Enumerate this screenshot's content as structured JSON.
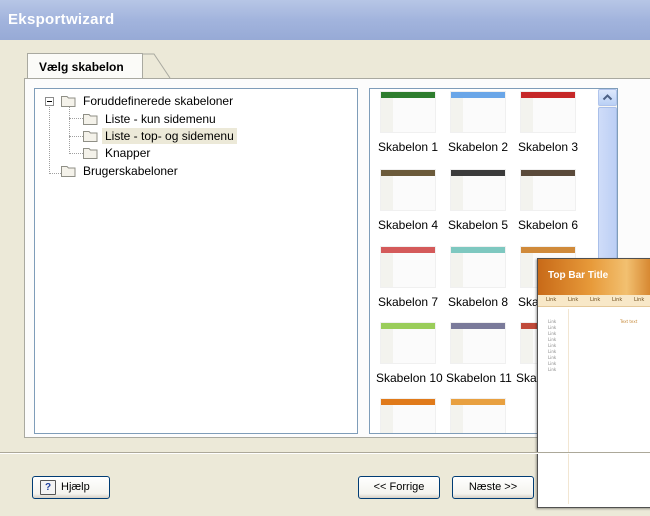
{
  "window": {
    "title": "Eksportwizard"
  },
  "tab": {
    "label": "Vælg skabelon"
  },
  "tree": {
    "root": "Foruddefinerede skabeloner",
    "children": [
      "Liste - kun sidemenu",
      "Liste - top- og sidemenu",
      "Knapper"
    ],
    "selected": "Liste - top- og sidemenu",
    "root2": "Brugerskabeloner"
  },
  "gallery": {
    "items": [
      {
        "label": "Skabelon 1",
        "color": "#2e7d2e"
      },
      {
        "label": "Skabelon 2",
        "color": "#6aa6e8"
      },
      {
        "label": "Skabelon 3",
        "color": "#c62828"
      },
      {
        "label": "Skabelon 4",
        "color": "#6b5a3a"
      },
      {
        "label": "Skabelon 5",
        "color": "#3b3b3b"
      },
      {
        "label": "Skabelon 6",
        "color": "#5a4a3a"
      },
      {
        "label": "Skabelon 7",
        "color": "#d45a5a"
      },
      {
        "label": "Skabelon 8",
        "color": "#7ec8c0"
      },
      {
        "label": "Ska",
        "color": "#d08a3a"
      },
      {
        "label": "Skabelon 10",
        "color": "#9acd5a"
      },
      {
        "label": "Skabelon 11",
        "color": "#7a7a9a"
      },
      {
        "label": "Ska",
        "color": "#c04a3a"
      },
      {
        "label": "",
        "color": "#e07a1a"
      },
      {
        "label": "",
        "color": "#e8a040"
      }
    ]
  },
  "preview": {
    "title": "Top Bar Title",
    "links": [
      "Link",
      "Link",
      "Link",
      "Link",
      "Link"
    ],
    "side_links": [
      "Link",
      "Link",
      "Link",
      "Link",
      "Link",
      "Link",
      "Link",
      "Link",
      "Link"
    ],
    "main_text": "Text text"
  },
  "buttons": {
    "help": "Hjælp",
    "help_icon": "?",
    "back": "<< Forrige",
    "next": "Næste >>"
  }
}
